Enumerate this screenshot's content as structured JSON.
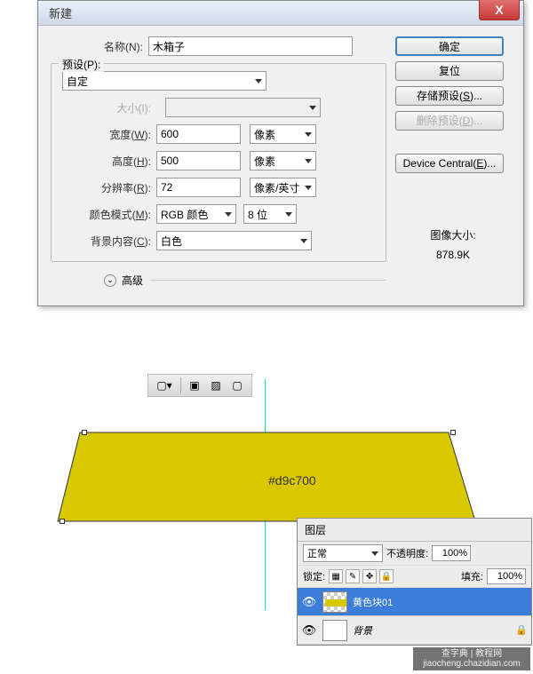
{
  "dialog": {
    "title": "新建",
    "close": "X",
    "name_label": "名称(N):",
    "name_value": "木箱子",
    "preset_label": "预设(P):",
    "preset_value": "自定",
    "size_label": "大小(I):",
    "width_label": "宽度(W):",
    "width_value": "600",
    "width_unit": "像素",
    "height_label": "高度(H):",
    "height_value": "500",
    "height_unit": "像素",
    "resolution_label": "分辨率(R):",
    "resolution_value": "72",
    "resolution_unit": "像素/英寸",
    "colormode_label": "颜色模式(M):",
    "colormode_value": "RGB 颜色",
    "bitdepth_value": "8 位",
    "bgcontent_label": "背景内容(C):",
    "bgcontent_value": "白色",
    "advanced_label": "高级",
    "buttons": {
      "ok": "确定",
      "reset": "复位",
      "save_preset": "存储预设(S)...",
      "delete_preset": "删除预设(D)...",
      "device_central": "Device Central(E)..."
    },
    "image_size_label": "图像大小:",
    "image_size_value": "878.9K"
  },
  "canvas": {
    "color_hex": "#d9c700"
  },
  "layers": {
    "tab": "图层",
    "blend_mode": "正常",
    "opacity_label": "不透明度:",
    "opacity_value": "100%",
    "lock_label": "锁定:",
    "fill_label": "填充:",
    "fill_value": "100%",
    "items": [
      {
        "name": "黄色块01"
      },
      {
        "name": "背景"
      }
    ]
  },
  "watermark": {
    "line1": "查字典 | 教程网",
    "line2": "jiaocheng.chazidian.com"
  }
}
